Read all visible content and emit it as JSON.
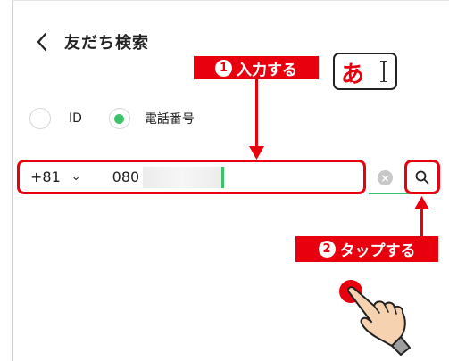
{
  "header": {
    "title": "友だち検索",
    "back_icon": "chevron-left-icon"
  },
  "callout1": {
    "number": "1",
    "text": "入力する"
  },
  "keyboard_hint": {
    "char": "あ"
  },
  "search_type": {
    "options": [
      {
        "label": "ID",
        "selected": false
      },
      {
        "label": "電話番号",
        "selected": true
      }
    ],
    "accent": "#3cc36a"
  },
  "phone_input": {
    "country_code": "+81",
    "number_prefix": "080"
  },
  "callout2": {
    "number": "2",
    "text": "タップする"
  },
  "colors": {
    "highlight": "#e8000e",
    "accent": "#3cc36a"
  }
}
